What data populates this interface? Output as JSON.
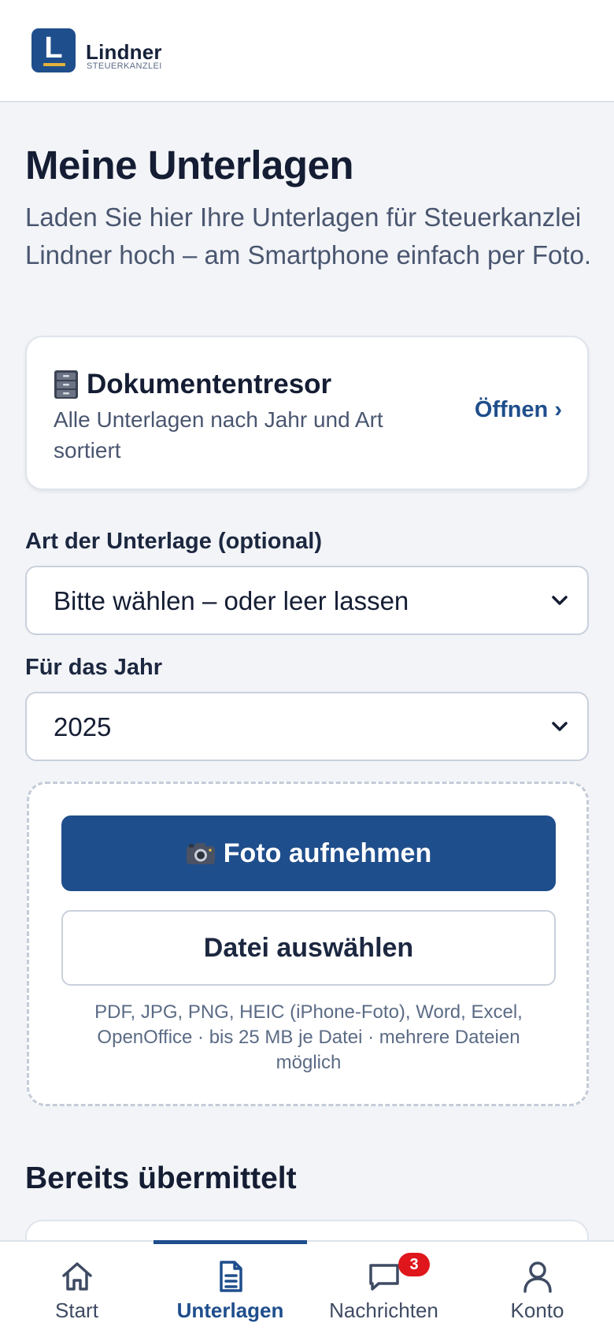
{
  "header": {
    "logo_letter": "L",
    "brand_name": "Lindner",
    "brand_sub": "STEUERKANZLEI"
  },
  "page": {
    "title": "Meine Unterlagen",
    "intro": "Laden Sie hier Ihre Unterlagen für Steuerkanzlei Lindner hoch – am Smartphone einfach per Foto."
  },
  "vault": {
    "icon": "file-cabinet-icon",
    "title": "Dokumententresor",
    "description": "Alle Unterlagen nach Jahr und Art sortiert",
    "open_label": "Öffnen ›"
  },
  "form": {
    "doc_type_label": "Art der Unterlage (optional)",
    "doc_type_value": "Bitte wählen – oder leer lassen",
    "year_label": "Für das Jahr",
    "year_value": "2025"
  },
  "upload": {
    "photo_icon": "camera-icon",
    "photo_label": "Foto aufnehmen",
    "file_label": "Datei auswählen",
    "hint": "PDF, JPG, PNG, HEIC (iPhone-Foto), Word, Excel, OpenOffice · bis 25 MB je Datei · mehrere Dateien möglich"
  },
  "submitted": {
    "title": "Bereits übermittelt"
  },
  "nav": {
    "items": [
      {
        "label": "Start",
        "icon": "home-icon"
      },
      {
        "label": "Unterlagen",
        "icon": "document-icon",
        "active": true
      },
      {
        "label": "Nachrichten",
        "icon": "chat-icon",
        "badge": "3"
      },
      {
        "label": "Konto",
        "icon": "user-icon"
      }
    ]
  },
  "colors": {
    "primary": "#1f4e8c",
    "accent_gold": "#e2b13c",
    "badge_red": "#e0161d",
    "background": "#f2f4f7"
  }
}
